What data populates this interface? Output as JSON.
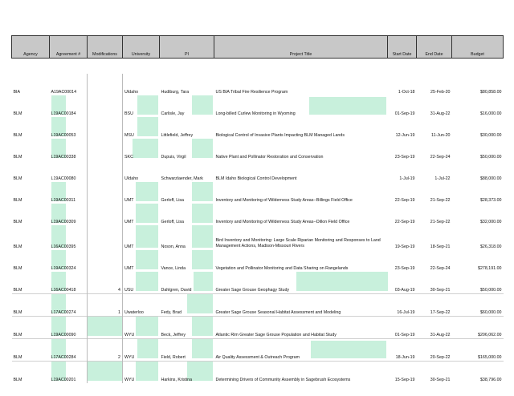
{
  "columns": [
    "Agency",
    "Agreement #",
    "Modifications",
    "University",
    "PI",
    "Project Title",
    "Start Date",
    "End Date",
    "Budget"
  ],
  "rows": [
    {
      "agency": "BIA",
      "agreement": "A19AC00014",
      "mods": "",
      "university": "UIdaho",
      "pi": "Hudiburg, Tara",
      "title": "US BIA Tribal Fire Resilience Program",
      "start": "1-Oct-18",
      "end": "25-Feb-20",
      "budget": "$80,858.00"
    },
    {
      "agency": "BLM",
      "agreement": "L19AC00184",
      "mods": "",
      "university": "BSU",
      "pi": "Carlisle, Jay",
      "title": "Long-billed Curlew Monitoring in Wyoming",
      "start": "01-Sep-19",
      "end": "31-Aug-22",
      "budget": "$16,000.00"
    },
    {
      "agency": "BLM",
      "agreement": "L19AC00053",
      "mods": "",
      "university": "MSU",
      "pi": "Littlefield, Jeffrey",
      "title": "Biological Control of Invasive Plants Impacting BLM Managed Lands",
      "start": "12-Jun-19",
      "end": "11-Jun-20",
      "budget": "$30,000.00"
    },
    {
      "agency": "BLM",
      "agreement": "L19AC00338",
      "mods": "",
      "university": "SKC",
      "pi": "Dupuis, Virgil",
      "title": "Native Plant and Pollinator Restoration and Conservation",
      "start": "23-Sep-19",
      "end": "22-Sep-24",
      "budget": "$50,000.00"
    },
    {
      "agency": "BLM",
      "agreement": "L19AC00080",
      "mods": "",
      "university": "UIdaho",
      "pi": "Schwarzlaender, Mark",
      "title": "BLM Idaho Biological Control Development",
      "start": "1-Jul-19",
      "end": "1-Jul-22",
      "budget": "$88,000.00"
    },
    {
      "agency": "BLM",
      "agreement": "L19AC00311",
      "mods": "",
      "university": "UMT",
      "pi": "Gerloff, Lisa",
      "title": "Inventory and Monitoring of Wilderness Study Areas--Billings Field Office",
      "start": "22-Sep-19",
      "end": "21-Sep-22",
      "budget": "$28,373.00"
    },
    {
      "agency": "BLM",
      "agreement": "L19AC00309",
      "mods": "",
      "university": "UMT",
      "pi": "Gerloff, Lisa",
      "title": "Inventory and Monitoring of Wilderness Study Areas--Dillon Field Office",
      "start": "22-Sep-19",
      "end": "21-Sep-22",
      "budget": "$32,000.00"
    },
    {
      "agency": "BLM",
      "agreement": "L16AC00395",
      "mods": "",
      "university": "UMT",
      "pi": "Noson, Anna",
      "title": "Bird Inventory and Monitoring: Large Scale Riparian Monitoring and Responses to Land Management Actions, Madison-Missouri Rivers",
      "start": "19-Sep-19",
      "end": "18-Sep-21",
      "budget": "$26,318.00"
    },
    {
      "agency": "BLM",
      "agreement": "L19AC00324",
      "mods": "",
      "university": "UMT",
      "pi": "Vance, Linda",
      "title": "Vegetation and Pollinator Monitoring and Data Sharing on Rangelands",
      "start": "23-Sep-19",
      "end": "22-Sep-24",
      "budget": "$278,191.00"
    },
    {
      "agency": "BLM",
      "agreement": "L16AC00418",
      "mods": "4",
      "university": "USU",
      "pi": "Dahlgren, David",
      "title": "Greater Sage Grouse Geophagy Study",
      "start": "03-Aug-19",
      "end": "30-Sep-21",
      "budget": "$50,000.00"
    },
    {
      "agency": "BLM",
      "agreement": "L17AC00274",
      "mods": "1",
      "university": "Uwaterloo",
      "pi": "Fedy, Brad",
      "title": "Greater Sage Grouse Seasonal Habitat Assessment and Modeling",
      "start": "16-Jul-19",
      "end": "17-Sep-22",
      "budget": "$60,000.00"
    },
    {
      "agency": "BLM",
      "agreement": "L19AC00090",
      "mods": "",
      "university": "WYU",
      "pi": "Beck, Jeffrey",
      "title": "Atlantic Rim Greater Sage Grouse Population and Habitat Study",
      "start": "01-Sep-19",
      "end": "31-Aug-22",
      "budget": "$206,062.00"
    },
    {
      "agency": "BLM",
      "agreement": "L17AC00284",
      "mods": "2",
      "university": "WYU",
      "pi": "Field, Robert",
      "title": "Air Quality Assessment & Outreach Program",
      "start": "18-Jun-19",
      "end": "20-Sep-22",
      "budget": "$165,000.00"
    },
    {
      "agency": "BLM",
      "agreement": "L19AC00201",
      "mods": "",
      "university": "WYU",
      "pi": "Harkins, Kristina",
      "title": "Determining Drivers of Community Assembly in Sagebrush Ecosystems",
      "start": "15-Sep-19",
      "end": "30-Sep-21",
      "budget": "$38,796.00"
    }
  ]
}
